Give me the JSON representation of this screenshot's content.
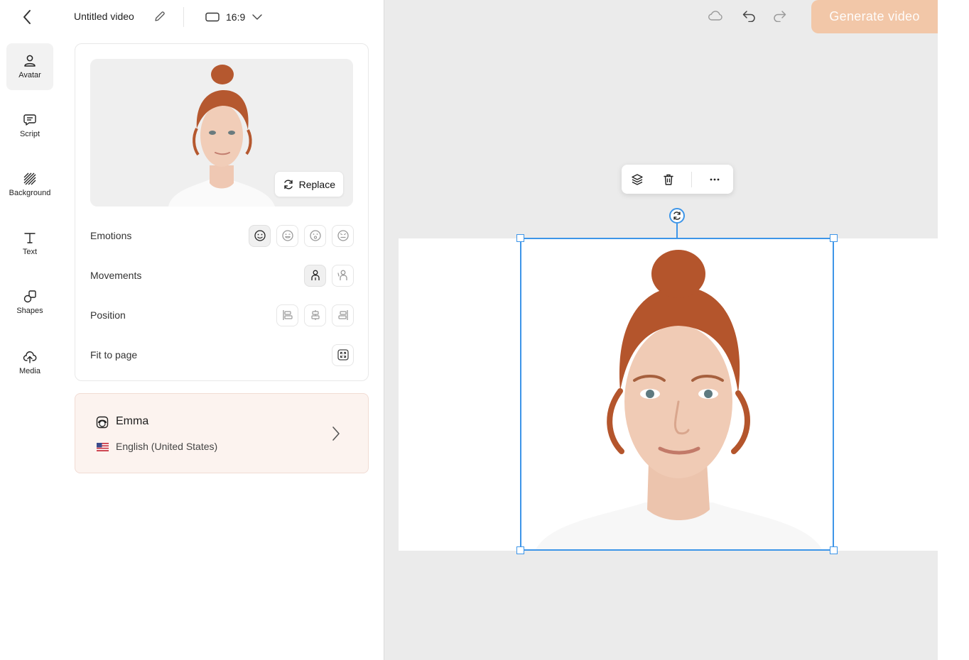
{
  "header": {
    "title": "Untitled video",
    "aspect_ratio": "16:9"
  },
  "rail": {
    "items": [
      {
        "label": "Avatar",
        "icon": "person-icon",
        "active": true
      },
      {
        "label": "Script",
        "icon": "chat-icon"
      },
      {
        "label": "Background",
        "icon": "hatch-icon"
      },
      {
        "label": "Text",
        "icon": "text-icon"
      },
      {
        "label": "Shapes",
        "icon": "shapes-icon"
      },
      {
        "label": "Media",
        "icon": "cloud-upload-icon"
      }
    ]
  },
  "panel": {
    "replace_label": "Replace",
    "rows": {
      "emotions": "Emotions",
      "movements": "Movements",
      "position": "Position",
      "fit": "Fit to page"
    }
  },
  "voice": {
    "name": "Emma",
    "language": "English (United States)"
  },
  "toolbar": {
    "generate_label": "Generate video"
  },
  "colors": {
    "accent": "#3d95e8",
    "generate_bg": "#f2c7a8",
    "voice_bg": "#fcf3ef",
    "canvas_bg": "#ebebeb"
  }
}
